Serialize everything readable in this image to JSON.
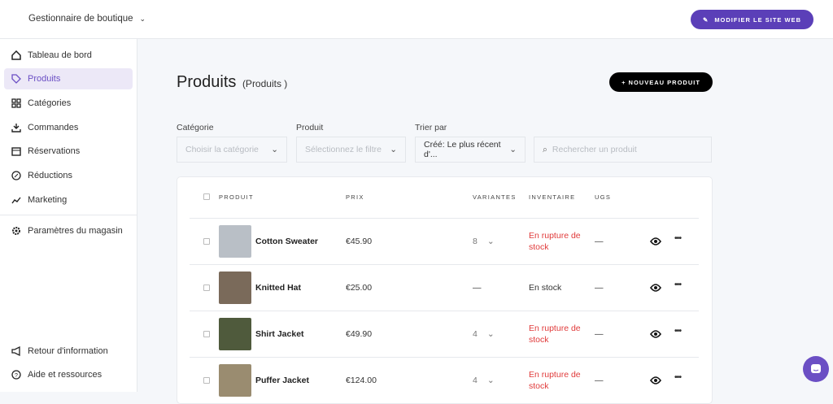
{
  "header": {
    "store": "Gestionnaire de boutique",
    "edit_site": "MODIFIER LE SITE WEB"
  },
  "sidebar": {
    "items": [
      {
        "label": "Tableau de bord",
        "icon": "home-icon"
      },
      {
        "label": "Produits",
        "icon": "tag-icon"
      },
      {
        "label": "Catégories",
        "icon": "grid-icon"
      },
      {
        "label": "Commandes",
        "icon": "download-icon"
      },
      {
        "label": "Réservations",
        "icon": "calendar-icon"
      },
      {
        "label": "Réductions",
        "icon": "discount-icon"
      },
      {
        "label": "Marketing",
        "icon": "trend-icon"
      },
      {
        "label": "Paramètres du magasin",
        "icon": "gear-icon"
      }
    ],
    "bottom": [
      {
        "label": "Retour d'information",
        "icon": "megaphone-icon"
      },
      {
        "label": "Aide et ressources",
        "icon": "help-icon"
      }
    ]
  },
  "page": {
    "title": "Produits",
    "subtitle": "(Produits  )",
    "new_product": "+ NOUVEAU PRODUIT"
  },
  "filters": {
    "category_label": "Catégorie",
    "category_placeholder": "Choisir la catégorie",
    "product_label": "Produit",
    "product_placeholder": "Sélectionnez le filtre",
    "sort_label": "Trier par",
    "sort_value": "Créé:  Le plus récent d'...",
    "search_placeholder": "Rechercher un produit"
  },
  "table": {
    "headers": [
      "PRODUIT",
      "PRIX",
      "VARIANTES",
      "INVENTAIRE",
      "UGS"
    ],
    "rows": [
      {
        "name": "Cotton Sweater",
        "price": "€45.90",
        "variants": "8",
        "inventory": "En rupture de stock",
        "out": true,
        "sku": "—",
        "thumb": "#b9bfc6"
      },
      {
        "name": "Knitted Hat",
        "price": "€25.00",
        "variants": "—",
        "inventory": "En stock",
        "out": false,
        "sku": "—",
        "thumb": "#7a6a5a"
      },
      {
        "name": "Shirt Jacket",
        "price": "€49.90",
        "variants": "4",
        "inventory": "En rupture de stock",
        "out": true,
        "sku": "—",
        "thumb": "#4f5a3c"
      },
      {
        "name": "Puffer Jacket",
        "price": "€124.00",
        "variants": "4",
        "inventory": "En rupture de stock",
        "out": true,
        "sku": "—",
        "thumb": "#9a8c70"
      }
    ]
  },
  "colors": {
    "accent": "#5b3fb8",
    "danger": "#e03a3a"
  }
}
